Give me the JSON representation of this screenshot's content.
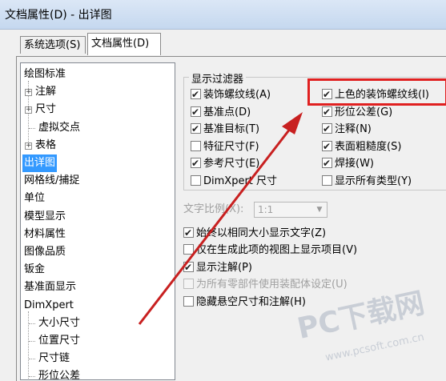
{
  "window": {
    "title": "文档属性(D) - 出详图"
  },
  "tabs": [
    {
      "label": "系统选项(S)",
      "active": false
    },
    {
      "label": "文档属性(D)",
      "active": true
    }
  ],
  "tree": {
    "items": [
      {
        "label": "绘图标准",
        "expander": "",
        "selected": false
      },
      {
        "label": "注解",
        "expander": "+",
        "selected": false
      },
      {
        "label": "尺寸",
        "expander": "+",
        "selected": false
      },
      {
        "label": "虚拟交点",
        "expander": "",
        "selected": false
      },
      {
        "label": "表格",
        "expander": "+",
        "selected": false
      },
      {
        "label": "出详图",
        "expander": "",
        "selected": true
      },
      {
        "label": "网格线/捕捉",
        "expander": "",
        "selected": false
      },
      {
        "label": "单位",
        "expander": "",
        "selected": false
      },
      {
        "label": "模型显示",
        "expander": "",
        "selected": false
      },
      {
        "label": "材料属性",
        "expander": "",
        "selected": false
      },
      {
        "label": "图像品质",
        "expander": "",
        "selected": false
      },
      {
        "label": "钣金",
        "expander": "",
        "selected": false
      },
      {
        "label": "基准面显示",
        "expander": "",
        "selected": false
      },
      {
        "label": "DimXpert",
        "expander": "",
        "selected": false
      },
      {
        "label": "大小尺寸",
        "expander": "",
        "selected": false
      },
      {
        "label": "位置尺寸",
        "expander": "",
        "selected": false
      },
      {
        "label": "尺寸链",
        "expander": "",
        "selected": false
      },
      {
        "label": "形位公差",
        "expander": "",
        "selected": false
      }
    ]
  },
  "display_filter": {
    "title": "显示过滤器",
    "left": [
      {
        "label": "装饰螺纹线(A)",
        "checked": true
      },
      {
        "label": "基准点(D)",
        "checked": true
      },
      {
        "label": "基准目标(T)",
        "checked": true
      },
      {
        "label": "特征尺寸(F)",
        "checked": false
      },
      {
        "label": "参考尺寸(E)",
        "checked": true
      },
      {
        "label": "DimXpert 尺寸",
        "checked": false
      }
    ],
    "right": [
      {
        "label": "上色的装饰螺纹线(I)",
        "checked": true
      },
      {
        "label": "形位公差(G)",
        "checked": true
      },
      {
        "label": "注释(N)",
        "checked": true
      },
      {
        "label": "表面粗糙度(S)",
        "checked": true
      },
      {
        "label": "焊接(W)",
        "checked": true
      },
      {
        "label": "显示所有类型(Y)",
        "checked": false
      }
    ]
  },
  "text_scale": {
    "label": "文字比例(X):",
    "value": "1:1"
  },
  "options": [
    {
      "label": "始终以相同大小显示文字(Z)",
      "checked": true,
      "enabled": true
    },
    {
      "label": "仅在生成此项的视图上显示项目(V)",
      "checked": false,
      "enabled": true
    },
    {
      "label": "显示注解(P)",
      "checked": true,
      "enabled": true
    },
    {
      "label": "为所有零部件使用装配体设定(U)",
      "checked": false,
      "enabled": false
    },
    {
      "label": "隐藏悬空尺寸和注解(H)",
      "checked": false,
      "enabled": true
    }
  ],
  "watermark": {
    "line1": "PC下载网",
    "line2": "www.pcsoft.com.cn"
  },
  "annotation": {
    "highlight_color": "#e02020",
    "arrow_color": "#c82020"
  }
}
